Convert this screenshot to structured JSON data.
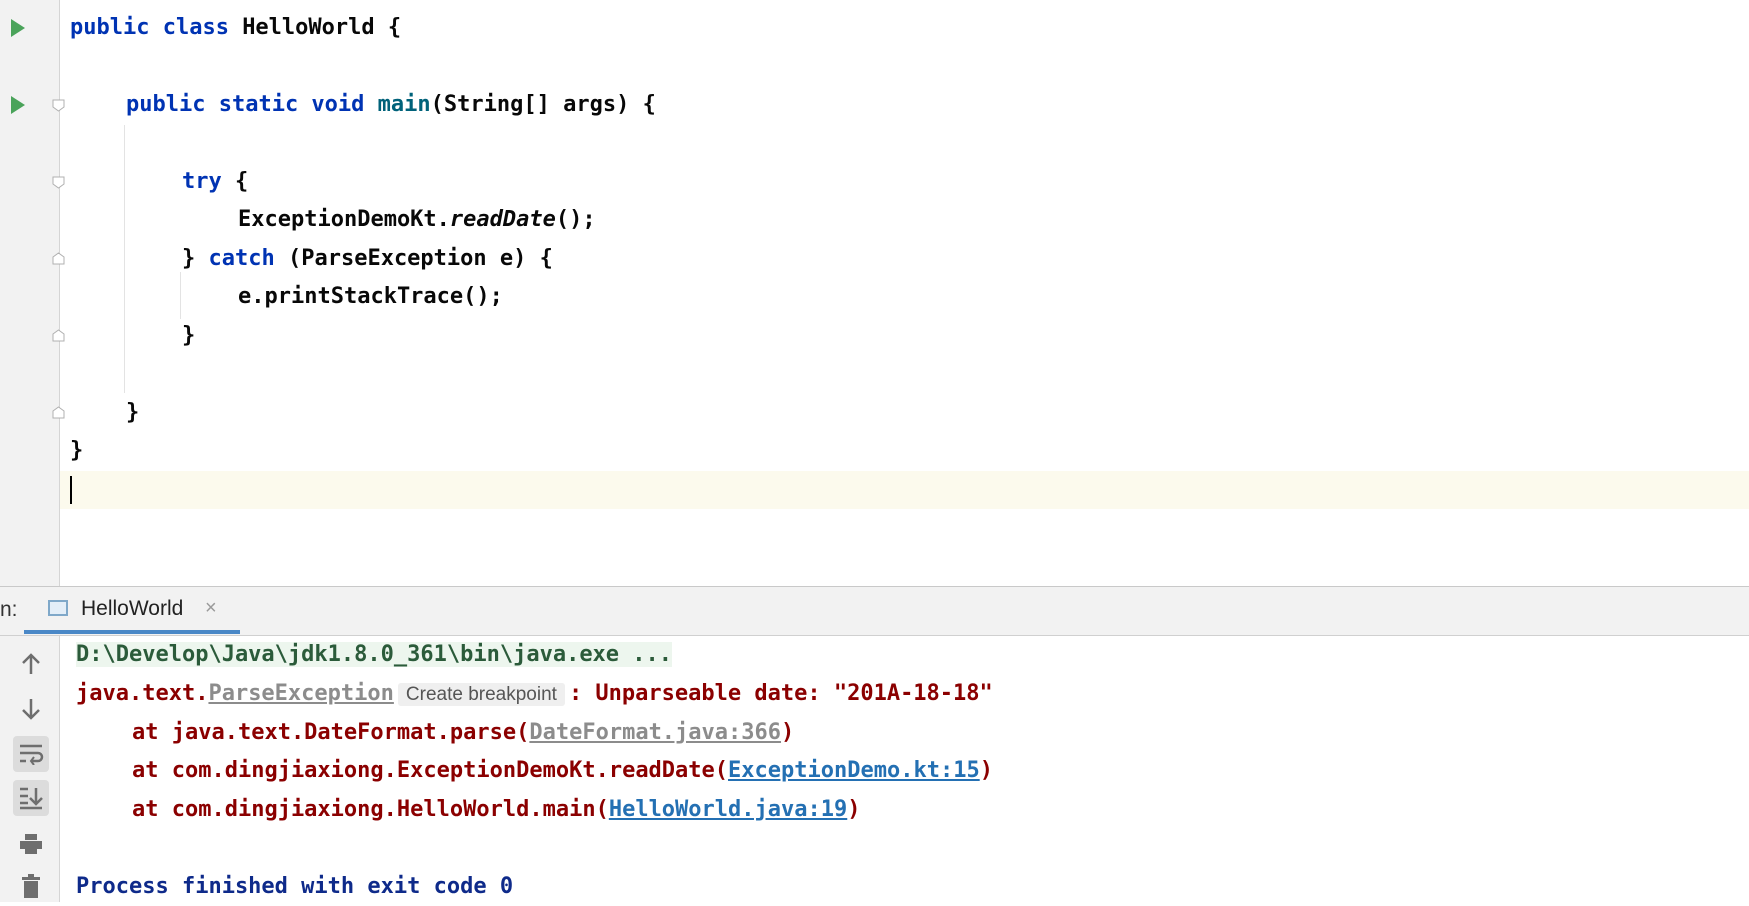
{
  "editor": {
    "lines": [
      {
        "kw1": "public class ",
        "name": "HelloWorld",
        "rest": " {"
      },
      {
        "kw1": "public static void ",
        "fn": "main",
        "rest": "(String[] args) {"
      },
      {
        "kw1": "try",
        "rest": " {"
      },
      {
        "cls": "ExceptionDemoKt.",
        "call": "readDate",
        "rest": "();"
      },
      {
        "pre": "} ",
        "kw1": "catch",
        "rest": " (ParseException e) {"
      },
      {
        "rest": "e.printStackTrace();"
      },
      {
        "rest": "}"
      },
      {
        "rest": "}"
      },
      {
        "rest": "}"
      }
    ]
  },
  "run_panel": {
    "title": "n:",
    "tab_label": "HelloWorld",
    "tab_close": "×",
    "console": {
      "command": "D:\\Develop\\Java\\jdk1.8.0_361\\bin\\java.exe ...",
      "exception_prefix": "java.text.",
      "exception_class": "ParseException",
      "breakpoint_chip": "Create breakpoint",
      "exception_message": ": Unparseable date: \"201A-18-18\"",
      "stack": [
        {
          "at": "at java.text.DateFormat.parse(",
          "link": "DateFormat.java:366",
          "end": ")"
        },
        {
          "at": "at com.dingjiaxiong.ExceptionDemoKt.readDate(",
          "link": "ExceptionDemo.kt:15",
          "end": ")"
        },
        {
          "at": "at com.dingjiaxiong.HelloWorld.main(",
          "link": "HelloWorld.java:19",
          "end": ")"
        }
      ],
      "finished": "Process finished with exit code 0"
    }
  },
  "icons": {
    "run": "run-triangle-icon",
    "fold": "fold-marker-icon",
    "up": "arrow-up-icon",
    "down": "arrow-down-icon",
    "wrap": "soft-wrap-icon",
    "scroll_end": "scroll-to-end-icon",
    "print": "print-icon",
    "trash": "trash-icon"
  },
  "colors": {
    "keyword": "#0033b3",
    "function": "#00627a",
    "error": "#8b0000",
    "link": "#2470b3"
  }
}
